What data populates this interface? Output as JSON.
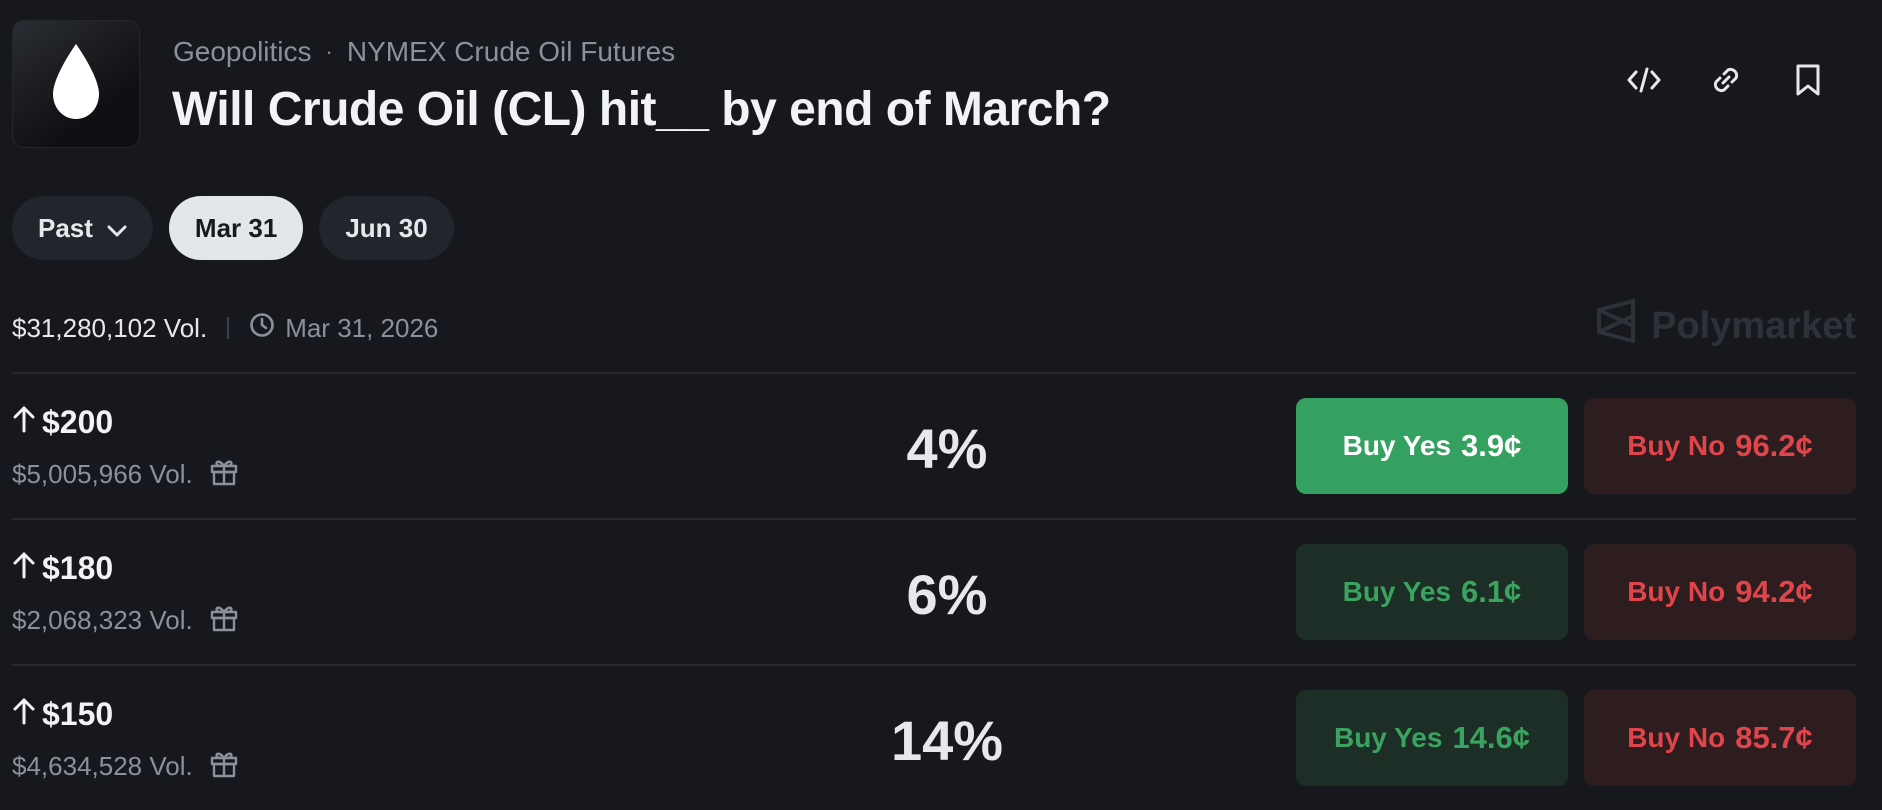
{
  "header": {
    "category": "Geopolitics",
    "separator": "·",
    "subcategory": "NYMEX Crude Oil Futures",
    "title": "Will Crude Oil (CL) hit__ by end of March?"
  },
  "icons": {
    "logo": "drop-icon",
    "embed": "code-icon",
    "link": "link-icon",
    "bookmark": "bookmark-icon"
  },
  "date_tabs": {
    "past_label": "Past",
    "tabs": [
      "Mar 31",
      "Jun 30"
    ],
    "selected": "Mar 31"
  },
  "meta": {
    "volume": "$31,280,102 Vol.",
    "end_date": "Mar 31, 2026",
    "brand": "Polymarket"
  },
  "markets": [
    {
      "target": "$200",
      "volume": "$5,005,966 Vol.",
      "chance": "4%",
      "yes_label": "Buy Yes",
      "yes_price": "3.9¢",
      "no_label": "Buy No",
      "no_price": "96.2¢"
    },
    {
      "target": "$180",
      "volume": "$2,068,323 Vol.",
      "chance": "6%",
      "yes_label": "Buy Yes",
      "yes_price": "6.1¢",
      "no_label": "Buy No",
      "no_price": "94.2¢"
    },
    {
      "target": "$150",
      "volume": "$4,634,528 Vol.",
      "chance": "14%",
      "yes_label": "Buy Yes",
      "yes_price": "14.6¢",
      "no_label": "Buy No",
      "no_price": "85.7¢"
    }
  ],
  "colors": {
    "background": "#16181d",
    "yes_green": "#35a160",
    "no_red": "#e0454b",
    "muted_text": "#8b919b"
  }
}
